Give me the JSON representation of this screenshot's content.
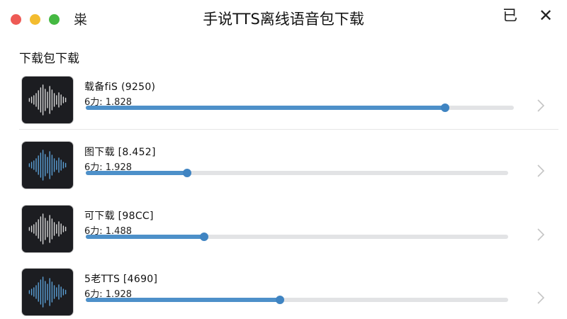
{
  "window": {
    "title": "手说TTS离线语音包下载",
    "app_glyph": "粜",
    "minimize_glyph": "已",
    "close_glyph": "✕"
  },
  "section": {
    "title": "下载包下载"
  },
  "colors": {
    "accent": "#4d90c9",
    "track": "#e2e3e5",
    "thumb_bg": "#1c1d21"
  },
  "packages": [
    {
      "name": "载备fiS (9250)",
      "detail": "6力: 1.828",
      "progress": 0.84,
      "wave_color": "#d9d9d9",
      "icon": "waveform-icon"
    },
    {
      "name": "图下载 [8.452]",
      "detail": "6力: 1.928",
      "progress": 0.24,
      "wave_color": "#5ba0d6",
      "icon": "waveform-icon"
    },
    {
      "name": "可下载 [98CC]",
      "detail": "6力: 1.488",
      "progress": 0.28,
      "wave_color": "#d9d9d9",
      "icon": "waveform-icon"
    },
    {
      "name": "5老TTS [4690]",
      "detail": "6力: 1.928",
      "progress": 0.46,
      "wave_color": "#5ba0d6",
      "icon": "waveform-icon"
    }
  ]
}
